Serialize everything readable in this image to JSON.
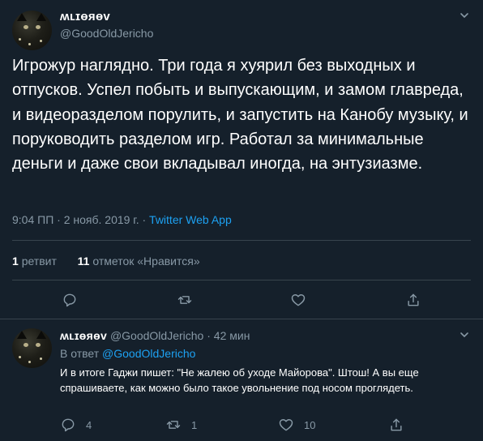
{
  "tweet": {
    "author_name": "ʍʟɪɵяɵv",
    "author_handle": "@GoodOldJericho",
    "text": "Игрожур наглядно. Три года я хуярил без выходных и отпусков. Успел побыть и выпускающим, и замом главреда, и видеоразделом порулить, и запустить на Канобу музыку, и поруководить разделом игр. Работал за минимальные деньги и даже свои вкладывал иногда, на энтузиазме.",
    "time": "9:04 ПП · 2 нояб. 2019 г. · ",
    "app": "Twitter Web App",
    "retweets_count": "1",
    "retweets_label": "ретвит",
    "likes_count": "11",
    "likes_label": "отметок «Нравится»"
  },
  "reply": {
    "author_name": "ʍʟɪɵяɵv",
    "author_handle": "@GoodOldJericho",
    "age": "· 42 мин",
    "reply_prefix": "В ответ ",
    "reply_to": "@GoodOldJericho",
    "text": "И в итоге Гаджи пишет: \"Не жалею об уходе Майорова\". Штош! А вы еще спрашиваете, как можно было такое увольнение под носом проглядеть.",
    "replies": "4",
    "retweets": "1",
    "likes": "10"
  },
  "icons": {
    "chevron": "chevron-down-icon",
    "reply": "reply-icon",
    "retweet": "retweet-icon",
    "like": "heart-icon",
    "share": "share-icon"
  },
  "colors": {
    "background": "#15202b",
    "text": "#ffffff",
    "secondary": "#8899a6",
    "accent": "#1da1f2",
    "divider": "#38444d"
  }
}
